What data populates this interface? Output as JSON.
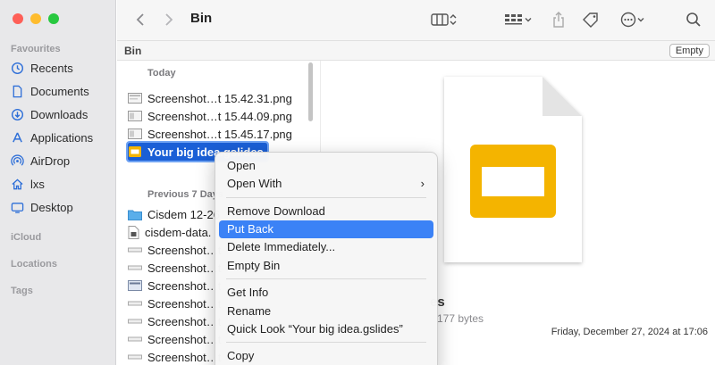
{
  "window": {
    "title": "Bin"
  },
  "sidebar": {
    "favourites_label": "Favourites",
    "items": [
      {
        "label": "Recents",
        "icon": "clock-icon"
      },
      {
        "label": "Documents",
        "icon": "document-icon"
      },
      {
        "label": "Downloads",
        "icon": "download-icon"
      },
      {
        "label": "Applications",
        "icon": "applications-icon"
      },
      {
        "label": "AirDrop",
        "icon": "airdrop-icon"
      },
      {
        "label": "lxs",
        "icon": "home-icon"
      },
      {
        "label": "Desktop",
        "icon": "desktop-icon"
      }
    ],
    "icloud_label": "iCloud",
    "locations_label": "Locations",
    "tags_label": "Tags"
  },
  "pathbar": {
    "label": "Bin",
    "empty_button": "Empty"
  },
  "list": {
    "today_header": "Today",
    "today": [
      "Screenshot…t 15.42.31.png",
      "Screenshot…t 15.44.09.png",
      "Screenshot…t 15.45.17.png"
    ],
    "selected_file": "Your big idea.gslides",
    "previous_header": "Previous 7 Days",
    "previous": [
      "Cisdem 12-26",
      "cisdem-data.",
      "Screenshot…t",
      "Screenshot…t",
      "Screenshot…t",
      "Screenshot…t",
      "Screenshot…t",
      "Screenshot…t",
      "Screenshot…t"
    ]
  },
  "preview": {
    "name_fragment": "es",
    "size_fragment": "177 bytes",
    "date": "Friday, December 27, 2024 at 17:06"
  },
  "context_menu": {
    "group1": [
      "Open",
      "Open With"
    ],
    "group2": [
      "Remove Download",
      "Put Back",
      "Delete Immediately...",
      "Empty Bin"
    ],
    "group3": [
      "Get Info",
      "Rename",
      "Quick Look “Your big idea.gslides”"
    ],
    "group4": [
      "Copy"
    ],
    "highlighted": "Put Back"
  },
  "colors": {
    "accent": "#1a5fd6",
    "menu_highlight": "#3b82f6",
    "slides_yellow": "#f4b400"
  }
}
